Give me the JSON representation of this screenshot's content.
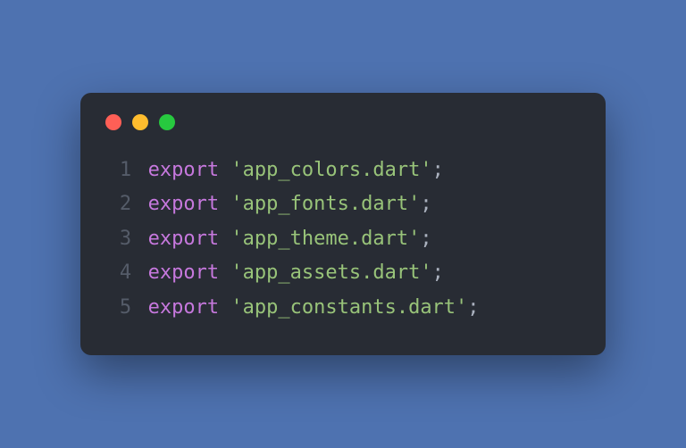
{
  "window": {
    "traffic_lights": [
      "red",
      "yellow",
      "green"
    ]
  },
  "code": {
    "keyword": "export",
    "lines": [
      {
        "n": "1",
        "str": "'app_colors.dart'"
      },
      {
        "n": "2",
        "str": "'app_fonts.dart'"
      },
      {
        "n": "3",
        "str": "'app_theme.dart'"
      },
      {
        "n": "4",
        "str": "'app_assets.dart'"
      },
      {
        "n": "5",
        "str": "'app_constants.dart'"
      }
    ],
    "terminator": ";"
  }
}
